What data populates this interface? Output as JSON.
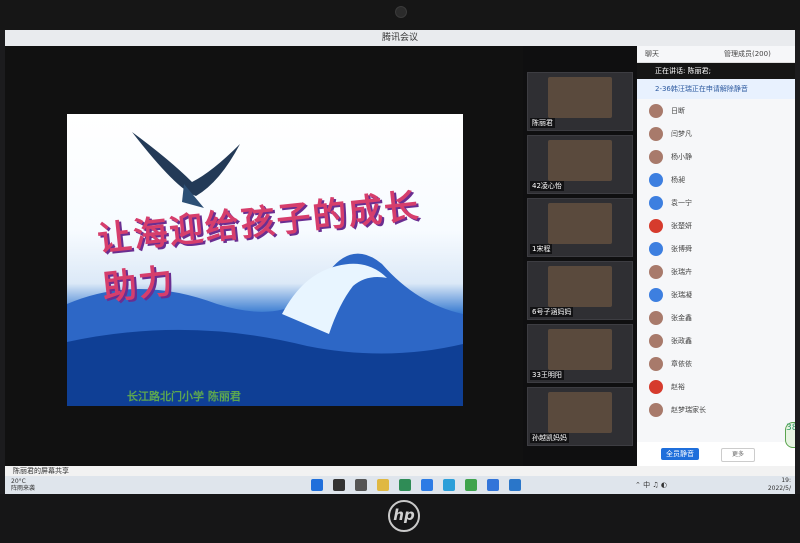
{
  "window_title": "腾讯会议",
  "slide": {
    "title": "让海迎给孩子的成长助力",
    "footer": "长江路北门小学    陈丽君"
  },
  "participants_video": [
    {
      "name": "陈丽君"
    },
    {
      "name": "42凌心怡"
    },
    {
      "name": "1宋程"
    },
    {
      "name": "6号子涵妈妈"
    },
    {
      "name": "33王明阳"
    },
    {
      "name": "孙越凯妈妈"
    }
  ],
  "panel": {
    "tabs": [
      "聊天",
      "管理成员(200)"
    ],
    "speaking": "正在讲话: 陈丽君;",
    "notice": "2-36韩汪瑞正在申请解除静音",
    "members": [
      "日断",
      "闫梦凡",
      "杨小静",
      "杨昶",
      "袁一宁",
      "张楚妍",
      "张博舜",
      "张瑞卉",
      "张瑞凝",
      "张金鑫",
      "张政鑫",
      "章依依",
      "赵裕",
      "赵梦瑞家长"
    ],
    "mute_all": "全员静音",
    "more": "更多"
  },
  "share_status": "陈丽君的屏幕共享",
  "taskbar": {
    "temp": "20°C",
    "weather": "阵雨来袭",
    "time": "19:",
    "date": "2022/5/"
  },
  "badge_text": "38",
  "brand": "hp"
}
